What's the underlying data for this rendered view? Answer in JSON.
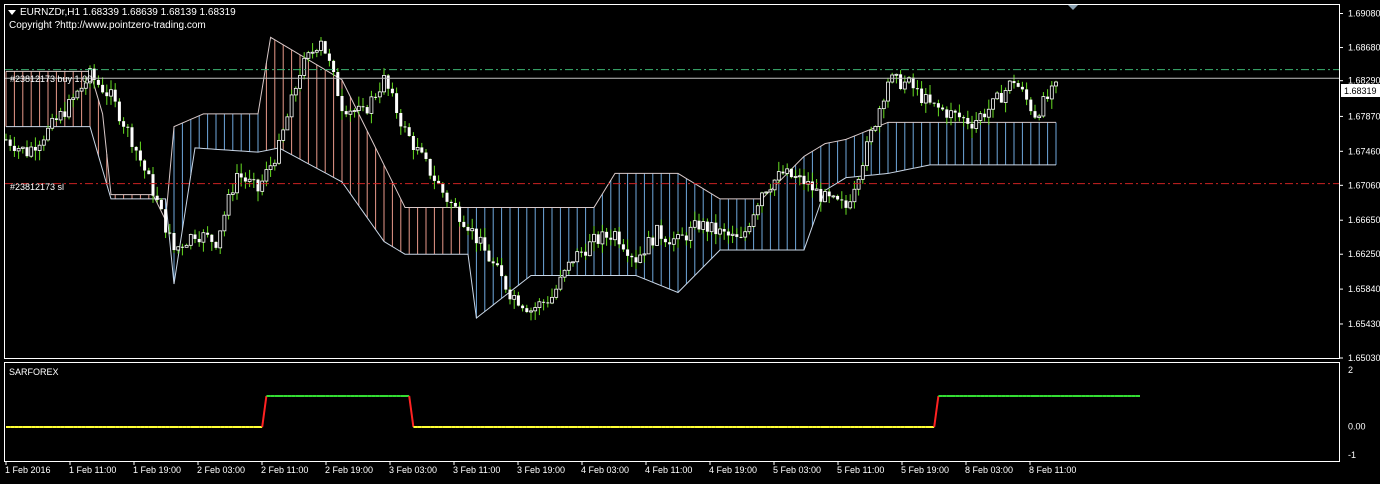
{
  "header": {
    "collapse_icon": "triangle-down-icon",
    "symbol_line": "EURNZDr,H1  1.68339 1.68639 1.68139 1.68319",
    "copyright": "Copyright ?http://www.pointzero-trading.com"
  },
  "main_chart": {
    "trade_buy_label": "#23812173 buy 1.00",
    "trade_sl_label": "#23812173 sl",
    "buy_price": 1.6842,
    "sl_price": 1.6708,
    "current_price_label": "1.68319",
    "current_price": 1.68319,
    "y_range": [
      1.6503,
      1.6918
    ],
    "price_ticks": [
      "1.69080",
      "1.68680",
      "1.68290",
      "1.67870",
      "1.67460",
      "1.67060",
      "1.66650",
      "1.66250",
      "1.65840",
      "1.65430",
      "1.65030"
    ],
    "colors": {
      "bull_body": "#ffffff",
      "bear_body": "#ffffff",
      "wick": "#66dd22",
      "cloud_up": "#6fa8dc",
      "cloud_down": "#e8998a",
      "buy_line": "#3cb371",
      "sl_line": "#cc2222",
      "current_line": "#c0c0c0"
    }
  },
  "sub_window": {
    "title": "SARFOREX",
    "ticks": [
      "2",
      "0.00",
      "-1"
    ],
    "y_range": [
      -1,
      2
    ],
    "levels": [
      0,
      0,
      0,
      0,
      0,
      0,
      0,
      0,
      0,
      0,
      0,
      0,
      0,
      0,
      0,
      0,
      0,
      0,
      0,
      0,
      0,
      0,
      0,
      0,
      0,
      0,
      0,
      0,
      0,
      0,
      0,
      0,
      0,
      0,
      0,
      0,
      0,
      0,
      0,
      0,
      0,
      0,
      0,
      0,
      0,
      0,
      0,
      0,
      0,
      0,
      0,
      0,
      0,
      0,
      0,
      0,
      0,
      0,
      0,
      0,
      0,
      0,
      1,
      1,
      1,
      1,
      1,
      1,
      1,
      1,
      1,
      1,
      1,
      1,
      1,
      1,
      1,
      1,
      1,
      1,
      1,
      1,
      1,
      1,
      1,
      1,
      1,
      1,
      1,
      1,
      1,
      1,
      1,
      1,
      1,
      1,
      1,
      0,
      0,
      0,
      0,
      0,
      0,
      0,
      0,
      0,
      0,
      0,
      0,
      0,
      0,
      0,
      0,
      0,
      0,
      0,
      0,
      0,
      0,
      0,
      0,
      0,
      0,
      0,
      0,
      0,
      0,
      0,
      0,
      0,
      0,
      0,
      0,
      0,
      0,
      0,
      0,
      0,
      0,
      0,
      0,
      0,
      0,
      0,
      0,
      0,
      0,
      0,
      0,
      0,
      0,
      0,
      0,
      0,
      0,
      0,
      0,
      0,
      0,
      0,
      0,
      0,
      0,
      0,
      0,
      0,
      0,
      0,
      0,
      0,
      0,
      0,
      0,
      0,
      0,
      0,
      0,
      0,
      0,
      0,
      0,
      0,
      0,
      0,
      0,
      0,
      0,
      0,
      0,
      0,
      0,
      0,
      0,
      0,
      0,
      0,
      0,
      0,
      0,
      0,
      0,
      0,
      0,
      0,
      0,
      0,
      0,
      0,
      0,
      0,
      0,
      0,
      0,
      0,
      0,
      0,
      0,
      0,
      0,
      0,
      0,
      0,
      1,
      1,
      1,
      1,
      1,
      1,
      1,
      1,
      1,
      1,
      1,
      1,
      1,
      1,
      1,
      1,
      1,
      1,
      1,
      1,
      1,
      1,
      1,
      1,
      1,
      1,
      1,
      1,
      1,
      1,
      1,
      1,
      1,
      1,
      1,
      1,
      1,
      1,
      1,
      1,
      1,
      1,
      1,
      1,
      1,
      1,
      1,
      1,
      1
    ],
    "colors": {
      "flat": "#ffff33",
      "up": "#33dd33",
      "transition": "#ff2222"
    }
  },
  "time_axis": {
    "labels": [
      "1 Feb 2016",
      "1 Feb 11:00",
      "1 Feb 19:00",
      "2 Feb 03:00",
      "2 Feb 11:00",
      "2 Feb 19:00",
      "3 Feb 03:00",
      "3 Feb 11:00",
      "3 Feb 19:00",
      "4 Feb 03:00",
      "4 Feb 11:00",
      "4 Feb 19:00",
      "5 Feb 03:00",
      "5 Feb 11:00",
      "5 Feb 19:00",
      "8 Feb 03:00",
      "8 Feb 11:00"
    ]
  },
  "chart_data": {
    "type": "candlestick",
    "symbol": "EURNZDr",
    "timeframe": "H1",
    "ohlc_last": {
      "open": 1.68339,
      "high": 1.68639,
      "low": 1.68139,
      "close": 1.68319
    },
    "x_tick_labels": [
      "1 Feb 2016",
      "1 Feb 11:00",
      "1 Feb 19:00",
      "2 Feb 03:00",
      "2 Feb 11:00",
      "2 Feb 19:00",
      "3 Feb 03:00",
      "3 Feb 11:00",
      "3 Feb 19:00",
      "4 Feb 03:00",
      "4 Feb 11:00",
      "4 Feb 19:00",
      "5 Feb 03:00",
      "5 Feb 11:00",
      "5 Feb 19:00",
      "8 Feb 03:00",
      "8 Feb 11:00"
    ],
    "close_path": [
      [
        0,
        1.676
      ],
      [
        5,
        1.6745
      ],
      [
        10,
        1.677
      ],
      [
        15,
        1.68
      ],
      [
        20,
        1.6835
      ],
      [
        25,
        1.681
      ],
      [
        30,
        1.676
      ],
      [
        35,
        1.67
      ],
      [
        40,
        1.663
      ],
      [
        45,
        1.665
      ],
      [
        50,
        1.664
      ],
      [
        55,
        1.672
      ],
      [
        60,
        1.67
      ],
      [
        65,
        1.675
      ],
      [
        70,
        1.684
      ],
      [
        75,
        1.688
      ],
      [
        80,
        1.68
      ],
      [
        85,
        1.679
      ],
      [
        90,
        1.683
      ],
      [
        95,
        1.677
      ],
      [
        100,
        1.673
      ],
      [
        105,
        1.669
      ],
      [
        110,
        1.666
      ],
      [
        115,
        1.662
      ],
      [
        120,
        1.658
      ],
      [
        125,
        1.656
      ],
      [
        130,
        1.6575
      ],
      [
        135,
        1.662
      ],
      [
        140,
        1.664
      ],
      [
        145,
        1.665
      ],
      [
        150,
        1.662
      ],
      [
        155,
        1.665
      ],
      [
        160,
        1.664
      ],
      [
        165,
        1.666
      ],
      [
        170,
        1.665
      ],
      [
        175,
        1.664
      ],
      [
        180,
        1.67
      ],
      [
        185,
        1.672
      ],
      [
        190,
        1.671
      ],
      [
        195,
        1.669
      ],
      [
        200,
        1.668
      ],
      [
        205,
        1.675
      ],
      [
        210,
        1.683
      ],
      [
        215,
        1.6825
      ],
      [
        220,
        1.68
      ],
      [
        225,
        1.679
      ],
      [
        230,
        1.678
      ],
      [
        235,
        1.68
      ],
      [
        240,
        1.683
      ],
      [
        245,
        1.679
      ],
      [
        250,
        1.682
      ]
    ],
    "cloud_top": [
      [
        0,
        1.684
      ],
      [
        20,
        1.684
      ],
      [
        23,
        1.679
      ],
      [
        25,
        1.6695
      ],
      [
        35,
        1.6695
      ],
      [
        38,
        1.6665
      ],
      [
        40,
        1.6775
      ],
      [
        47,
        1.679
      ],
      [
        60,
        1.679
      ],
      [
        63,
        1.688
      ],
      [
        80,
        1.683
      ],
      [
        95,
        1.668
      ],
      [
        100,
        1.668
      ],
      [
        106,
        1.668
      ],
      [
        110,
        1.668
      ],
      [
        140,
        1.668
      ],
      [
        145,
        1.672
      ],
      [
        160,
        1.672
      ],
      [
        170,
        1.669
      ],
      [
        180,
        1.669
      ],
      [
        190,
        1.674
      ],
      [
        195,
        1.6755
      ],
      [
        200,
        1.676
      ],
      [
        210,
        1.678
      ],
      [
        220,
        1.678
      ],
      [
        250,
        1.678
      ]
    ],
    "cloud_bottom": [
      [
        0,
        1.6775
      ],
      [
        20,
        1.6775
      ],
      [
        25,
        1.669
      ],
      [
        38,
        1.669
      ],
      [
        40,
        1.659
      ],
      [
        45,
        1.675
      ],
      [
        60,
        1.6745
      ],
      [
        65,
        1.675
      ],
      [
        80,
        1.671
      ],
      [
        90,
        1.664
      ],
      [
        95,
        1.6625
      ],
      [
        110,
        1.6625
      ],
      [
        112,
        1.655
      ],
      [
        125,
        1.66
      ],
      [
        150,
        1.66
      ],
      [
        160,
        1.658
      ],
      [
        170,
        1.663
      ],
      [
        190,
        1.663
      ],
      [
        195,
        1.67
      ],
      [
        200,
        1.6715
      ],
      [
        210,
        1.672
      ],
      [
        220,
        1.673
      ],
      [
        250,
        1.673
      ]
    ],
    "cloud_colors": [
      "down",
      "down",
      "down",
      "down",
      "down",
      "down",
      "up",
      "up",
      "down",
      "down",
      "down",
      "down",
      "down",
      "down",
      "down",
      "down",
      "down",
      "down",
      "up",
      "up",
      "up",
      "up",
      "up",
      "up",
      "up",
      "up"
    ]
  }
}
